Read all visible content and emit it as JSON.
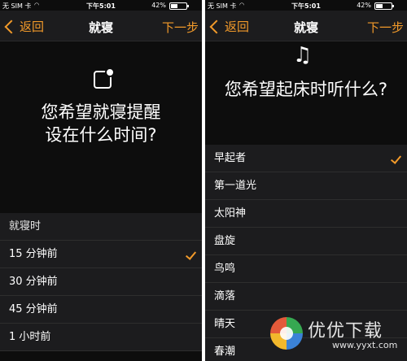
{
  "statusbar": {
    "carrier": "无 SIM 卡",
    "time": "下午5:01",
    "battery": "42%"
  },
  "left": {
    "nav": {
      "back": "返回",
      "title": "就寝",
      "next": "下一步"
    },
    "question_line1": "您希望就寝提醒",
    "question_line2": "设在什么时间?",
    "list_header": "就寝时",
    "options": [
      "15 分钟前",
      "30 分钟前",
      "45 分钟前",
      "1 小时前"
    ],
    "selected": "15 分钟前"
  },
  "right": {
    "nav": {
      "back": "返回",
      "title": "就寝",
      "next": "下一步"
    },
    "question": "您希望起床时听什么?",
    "options": [
      "早起者",
      "第一道光",
      "太阳神",
      "盘旋",
      "鸟鸣",
      "滴落",
      "晴天",
      "春潮"
    ],
    "selected": "早起者"
  },
  "watermark": {
    "name": "优优下载",
    "url": "www.yyxt.com"
  },
  "colors": {
    "accent": "#f29a2a",
    "background": "#0d0d0d",
    "list": "#1c1c1e"
  }
}
